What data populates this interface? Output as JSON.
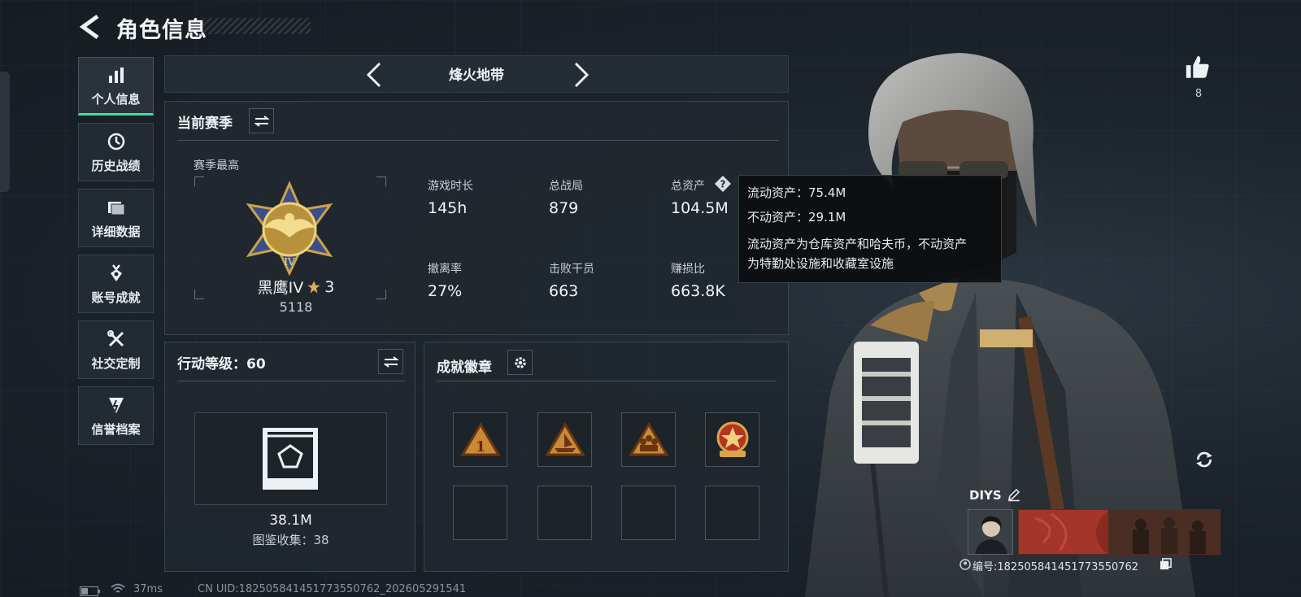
{
  "header": {
    "title": "角色信息"
  },
  "sidebar": {
    "items": [
      {
        "label": "个人信息",
        "icon": "bar-chart-icon",
        "active": true
      },
      {
        "label": "历史战绩",
        "icon": "history-icon"
      },
      {
        "label": "详细数据",
        "icon": "folder-icon"
      },
      {
        "label": "账号成就",
        "icon": "medal-icon"
      },
      {
        "label": "社交定制",
        "icon": "tools-icon"
      },
      {
        "label": "信誉档案",
        "icon": "shield-icon"
      }
    ]
  },
  "mode": {
    "title": "烽火地带"
  },
  "season": {
    "title": "当前赛季",
    "best_label": "赛季最高",
    "rank_name": "黑鹰IV",
    "rank_stars": "3",
    "rank_score": "5118",
    "stats": [
      {
        "label": "游戏时长",
        "value": "145h"
      },
      {
        "label": "总战局",
        "value": "879"
      },
      {
        "label": "总资产",
        "value": "104.5M"
      },
      {
        "label": "撤离率",
        "value": "27%"
      },
      {
        "label": "击败干员",
        "value": "663"
      },
      {
        "label": "赚损比",
        "value": "663.8K"
      }
    ]
  },
  "tooltip": {
    "liquid": "流动资产：75.4M",
    "fixed": "不动资产：29.1M",
    "desc_line1": "流动资产为仓库资产和哈夫币，不动资产",
    "desc_line2": "为特勤处设施和收藏室设施"
  },
  "action_level": {
    "title": "行动等级：60",
    "value": "38.1M",
    "collection": "图鉴收集：38"
  },
  "achievements": {
    "title": "成就徽章"
  },
  "likes": {
    "count": "8"
  },
  "profile": {
    "name": "DIYS",
    "id_text": "编号:182505841451773550762"
  },
  "footer": {
    "ping": "37ms",
    "uid": "CN UID:182505841451773550762_202605291541"
  },
  "colors": {
    "accent": "#3fe0a0",
    "gold": "#c9a24a",
    "panel": "#21282f"
  }
}
